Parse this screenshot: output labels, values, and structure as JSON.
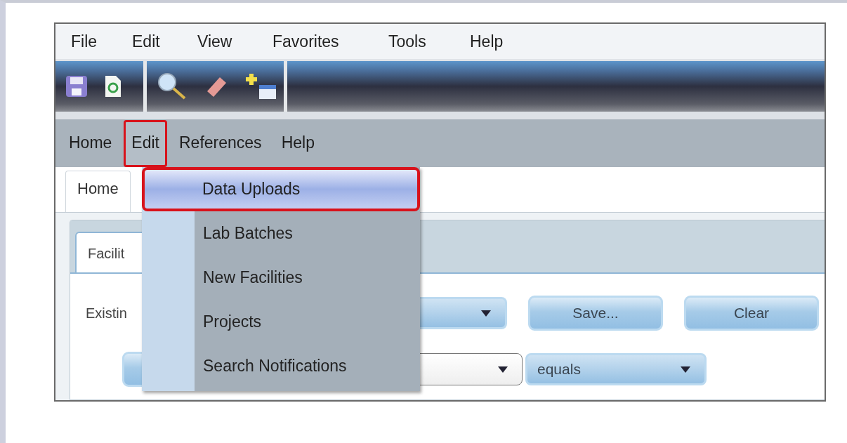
{
  "menu_bar": [
    {
      "label": "File"
    },
    {
      "label": "Edit"
    },
    {
      "label": "View"
    },
    {
      "label": "Favorites"
    },
    {
      "label": "Tools"
    },
    {
      "label": "Help"
    }
  ],
  "app_menu": [
    {
      "label": "Home",
      "selected": false
    },
    {
      "label": "Edit",
      "selected": true
    },
    {
      "label": "References",
      "selected": false
    },
    {
      "label": "Help",
      "selected": false
    }
  ],
  "tabs": [
    {
      "label": "Home",
      "selected": true
    }
  ],
  "edit_dropdown": [
    {
      "label": "Data Uploads",
      "selected": true
    },
    {
      "label": "Lab Batches",
      "selected": false
    },
    {
      "label": "New Facilities",
      "selected": false
    },
    {
      "label": "Projects",
      "selected": false
    },
    {
      "label": "Search Notifications",
      "selected": false
    }
  ],
  "panel": {
    "tab": "Facilit",
    "label": "Existin",
    "buttons": [
      "Save...",
      "Clear"
    ],
    "operator": "equals"
  }
}
